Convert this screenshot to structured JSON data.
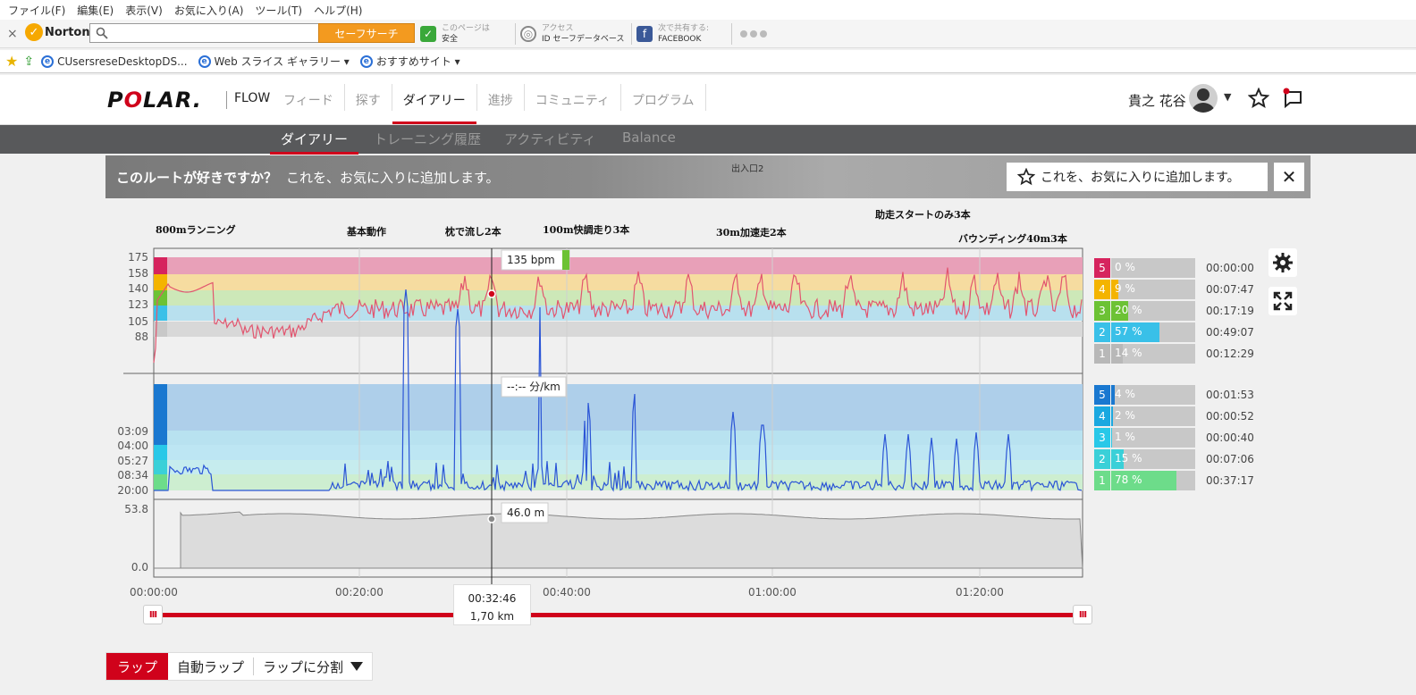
{
  "menu": [
    "ファイル(F)",
    "編集(E)",
    "表示(V)",
    "お気に入り(A)",
    "ツール(T)",
    "ヘルプ(H)"
  ],
  "norton": {
    "close": "×",
    "logo": "Norton",
    "search_button": "セーフサーチ",
    "safe_line1": "このページは",
    "safe_line2": "安全",
    "access_line1": "アクセス",
    "access_line2": "ID セーフデータベース",
    "share_line1": "次で共有する:",
    "share_line2": "FACEBOOK"
  },
  "favorites": [
    {
      "label": "CUsersreseDesktopDS..."
    },
    {
      "label": "Web スライス ギャラリー ▾"
    },
    {
      "label": "おすすめサイト ▾"
    }
  ],
  "header": {
    "flow": "FLOW",
    "nav": [
      "フィード",
      "探す",
      "ダイアリー",
      "進捗",
      "コミュニティ",
      "プログラム"
    ],
    "user_name": "貴之 花谷"
  },
  "subnav": [
    "ダイアリー",
    "トレーニング履歴",
    "アクティビティ",
    "Balance"
  ],
  "banner": {
    "map_label": "出入口2",
    "question": "このルートが好きですか？",
    "sub": "これを、お気に入りに追加します。",
    "fav_button": "これを、お気に入りに追加します。",
    "close": "✕"
  },
  "laps": [
    {
      "label": "800mランニング"
    },
    {
      "label": "基本動作"
    },
    {
      "label": "枕で流し2本"
    },
    {
      "label": "100m快調走り3本"
    },
    {
      "label": "30m加速走2本"
    },
    {
      "label": "助走スタートのみ3本"
    },
    {
      "label": "バウンディング40m3本"
    }
  ],
  "tooltips": {
    "hr": "135 bpm",
    "pace": "--:-- 分/km",
    "alt": "46.0 m"
  },
  "cursor": {
    "time": "00:32:46",
    "distance": "1,70 km"
  },
  "chart_data": {
    "type": "line",
    "x_ticks": [
      "00:00:00",
      "00:20:00",
      "00:40:00",
      "01:00:00",
      "01:20:00"
    ],
    "hr": {
      "y_ticks": [
        "175",
        "158",
        "140",
        "123",
        "105",
        "88"
      ],
      "zones": [
        {
          "zone": 5,
          "color": "#e8a0b8"
        },
        {
          "zone": 4,
          "color": "#f6dca0"
        },
        {
          "zone": 3,
          "color": "#cde8b8"
        },
        {
          "zone": 2,
          "color": "#b8e0ee"
        },
        {
          "zone": 1,
          "color": "#d8d8d8"
        }
      ]
    },
    "pace": {
      "y_ticks": [
        "03:09",
        "04:00",
        "05:27",
        "08:34",
        "20:00"
      ]
    },
    "altitude": {
      "y_ticks": [
        "53.8",
        "0.0"
      ]
    }
  },
  "hr_zones": [
    {
      "zone": "5",
      "pct": "0 %",
      "pct_value": 0,
      "time": "00:00:00",
      "color": "#d6245e"
    },
    {
      "zone": "4",
      "pct": "9 %",
      "pct_value": 9,
      "time": "00:07:47",
      "color": "#f4b400"
    },
    {
      "zone": "3",
      "pct": "20 %",
      "pct_value": 20,
      "time": "00:17:19",
      "color": "#6cc234"
    },
    {
      "zone": "2",
      "pct": "57 %",
      "pct_value": 57,
      "time": "00:49:07",
      "color": "#39c0e8"
    },
    {
      "zone": "1",
      "pct": "14 %",
      "pct_value": 14,
      "time": "00:12:29",
      "color": "#b8b8b8"
    }
  ],
  "pace_zones": [
    {
      "zone": "5",
      "pct": "4 %",
      "pct_value": 4,
      "time": "00:01:53",
      "color": "#1a78d0"
    },
    {
      "zone": "4",
      "pct": "2 %",
      "pct_value": 2,
      "time": "00:00:52",
      "color": "#1aa8e0"
    },
    {
      "zone": "3",
      "pct": "1 %",
      "pct_value": 1,
      "time": "00:00:40",
      "color": "#28c8e8"
    },
    {
      "zone": "2",
      "pct": "15 %",
      "pct_value": 15,
      "time": "00:07:06",
      "color": "#3ad0d8"
    },
    {
      "zone": "1",
      "pct": "78 %",
      "pct_value": 78,
      "time": "00:37:17",
      "color": "#6ddc8a"
    }
  ],
  "lap_buttons": {
    "lap": "ラップ",
    "autolap": "自動ラップ",
    "split": "ラップに分割"
  }
}
